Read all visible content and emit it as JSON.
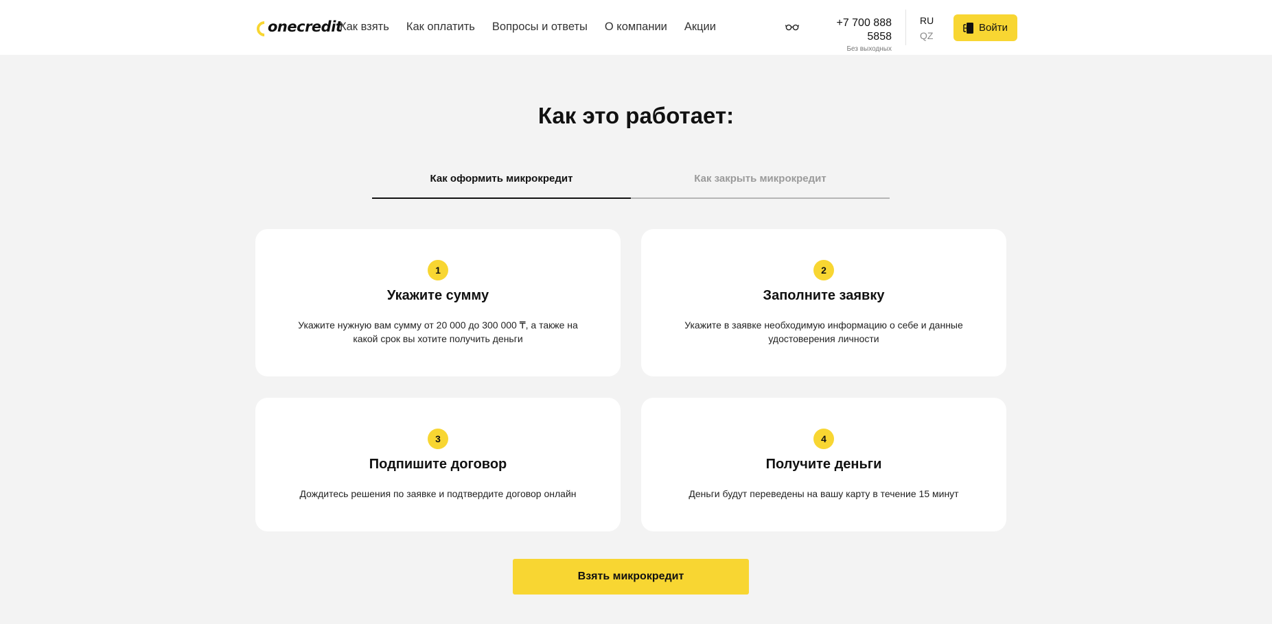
{
  "header": {
    "logo_text": "onecredit",
    "nav": [
      "Как взять",
      "Как оплатить",
      "Вопросы и ответы",
      "О компании",
      "Акции"
    ],
    "phone": "+7 700 888 5858",
    "phone_note": "Без выходных",
    "lang_active": "RU",
    "lang_other": "QZ",
    "login_label": "Войти",
    "accent_color": "#f8d632"
  },
  "main": {
    "title": "Как это работает:",
    "tabs": [
      {
        "label": "Как оформить микрокредит",
        "active": true
      },
      {
        "label": "Как закрыть микрокредит",
        "active": false
      }
    ],
    "steps": [
      {
        "number": "1",
        "title": "Укажите сумму",
        "text": "Укажите нужную вам сумму от 20 000 до 300 000 ₸, а также на какой срок вы хотите получить деньги"
      },
      {
        "number": "2",
        "title": "Заполните заявку",
        "text": "Укажите в заявке необходимую информацию о себе и данные удостоверения личности"
      },
      {
        "number": "3",
        "title": "Подпишите договор",
        "text": "Дождитесь решения по заявке и подтвердите договор онлайн"
      },
      {
        "number": "4",
        "title": "Получите деньги",
        "text": "Деньги будут переведены на вашу карту в течение 15 минут"
      }
    ],
    "cta_label": "Взять микрокредит"
  }
}
